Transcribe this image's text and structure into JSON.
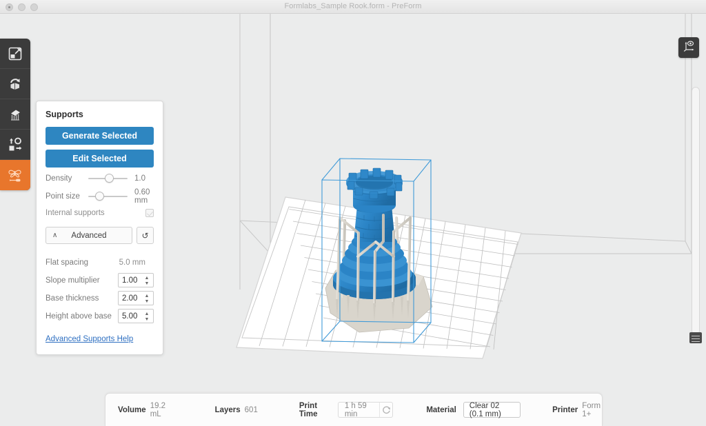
{
  "window": {
    "title": "Formlabs_Sample Rook.form - PreForm",
    "traffic_lights": [
      "close",
      "minimize",
      "zoom"
    ]
  },
  "toolbar": {
    "items": [
      {
        "name": "scale-tool",
        "icon": "scale-icon",
        "active": false
      },
      {
        "name": "orientation-tool",
        "icon": "rotate-icon",
        "active": false
      },
      {
        "name": "supports-tool",
        "icon": "supports-icon",
        "active": false
      },
      {
        "name": "layout-tool",
        "icon": "layout-icon",
        "active": false
      },
      {
        "name": "finishing-tool",
        "icon": "butterfly-icon",
        "active": true
      }
    ],
    "active_color": "#e8762c",
    "background": "#3b3b3b"
  },
  "gizmo": {
    "name": "view-orientation-gizmo",
    "icon": "axis-eye-icon"
  },
  "vertical_slider": {
    "name": "model-height-slider",
    "value_position": "bottom"
  },
  "panel": {
    "title": "Supports",
    "generate_label": "Generate Selected",
    "edit_label": "Edit Selected",
    "accent": "#2e86c1",
    "density": {
      "label": "Density",
      "value": "1.0",
      "knob_pct": 55
    },
    "point_size": {
      "label": "Point size",
      "value": "0.60 mm",
      "knob_pct": 22
    },
    "internal_supports": {
      "label": "Internal supports",
      "checked": true
    },
    "advanced_label": "Advanced",
    "advanced_chevron": "∧",
    "reset_icon": "↺",
    "fields": [
      {
        "label": "Flat spacing",
        "value": "5.0 mm",
        "type": "text"
      },
      {
        "label": "Slope multiplier",
        "value": "1.00",
        "type": "spinner"
      },
      {
        "label": "Base thickness",
        "value": "2.00",
        "type": "spinner"
      },
      {
        "label": "Height above base",
        "value": "5.00",
        "type": "spinner"
      }
    ],
    "help_link": "Advanced Supports Help"
  },
  "statusbar": {
    "volume_label": "Volume",
    "volume_value": "19.2 mL",
    "layers_label": "Layers",
    "layers_value": "601",
    "print_time_label": "Print Time",
    "print_time_value": "1 h 59 min",
    "refresh_icon": "recalculate-icon",
    "material_label": "Material",
    "material_value": "Clear 02 (0.1 mm)",
    "printer_label": "Printer",
    "printer_value": "Form 1+"
  },
  "scene": {
    "model_color": "#2b84c6",
    "support_color": "#cfcbc2",
    "bbox_color": "#3f9ad8",
    "platform_color": "#ffffff",
    "grid_color": "#b9b9b9",
    "build_volume_color": "#c2c2c2"
  }
}
